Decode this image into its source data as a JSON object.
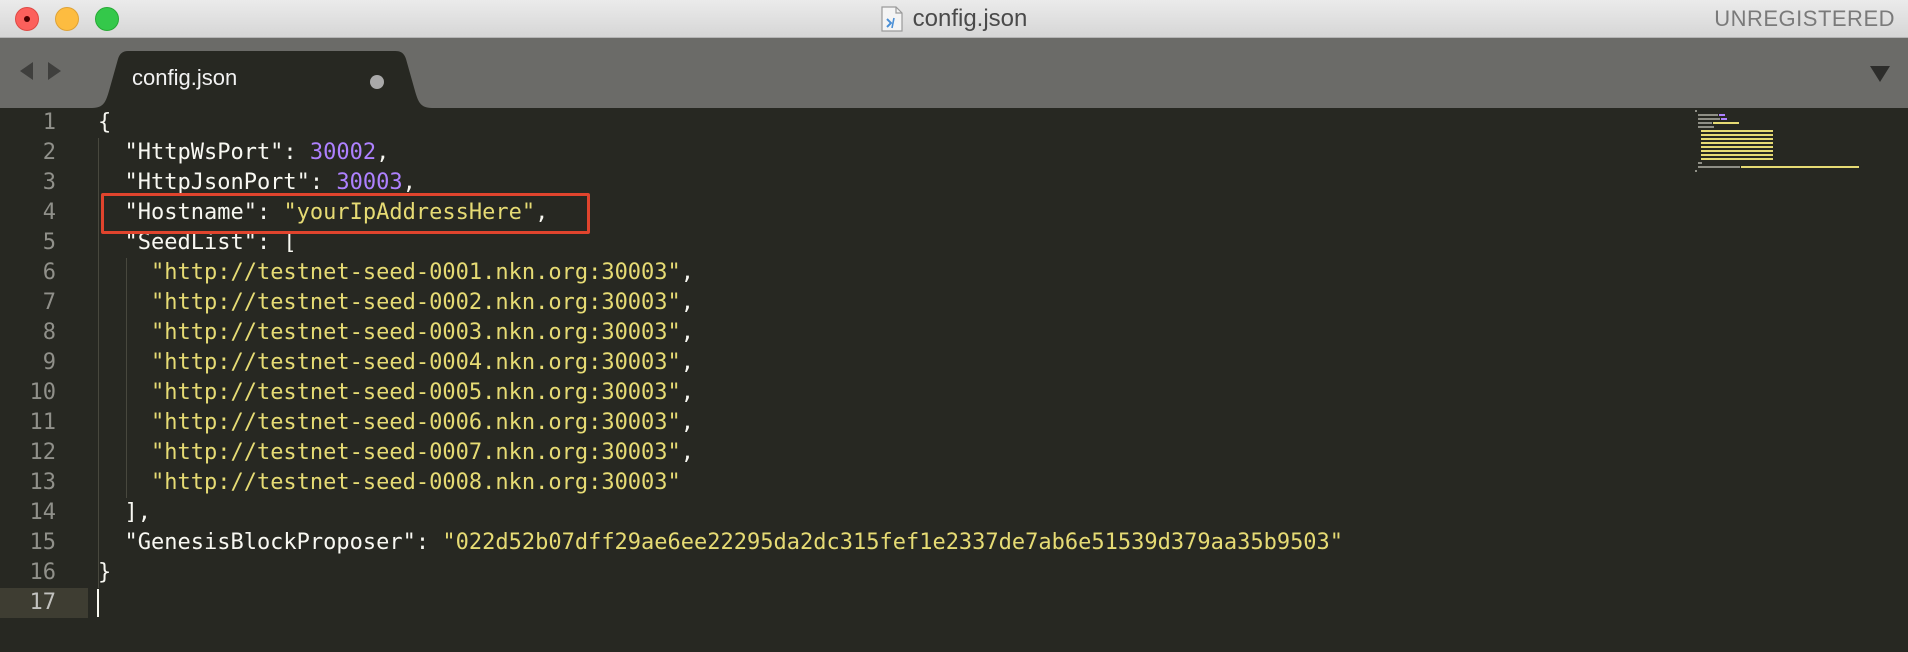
{
  "window": {
    "title": "config.json",
    "license_status": "UNREGISTERED"
  },
  "tabs": [
    {
      "label": "config.json",
      "modified": true
    }
  ],
  "editor": {
    "lines": [
      {
        "n": "1",
        "tokens": [
          {
            "t": "{",
            "c": "key"
          }
        ]
      },
      {
        "n": "2",
        "tokens": [
          {
            "t": "  \"HttpWsPort\": ",
            "c": "key"
          },
          {
            "t": "30002",
            "c": "num"
          },
          {
            "t": ",",
            "c": "key"
          }
        ]
      },
      {
        "n": "3",
        "tokens": [
          {
            "t": "  \"HttpJsonPort\": ",
            "c": "key"
          },
          {
            "t": "30003",
            "c": "num"
          },
          {
            "t": ",",
            "c": "key"
          }
        ]
      },
      {
        "n": "4",
        "tokens": [
          {
            "t": "  \"Hostname\": ",
            "c": "key"
          },
          {
            "t": "\"yourIpAddressHere\"",
            "c": "str"
          },
          {
            "t": ",",
            "c": "key"
          }
        ]
      },
      {
        "n": "5",
        "tokens": [
          {
            "t": "  \"SeedList\": [",
            "c": "key"
          }
        ]
      },
      {
        "n": "6",
        "tokens": [
          {
            "t": "    ",
            "c": "key"
          },
          {
            "t": "\"http://testnet-seed-0001.nkn.org:30003\"",
            "c": "str"
          },
          {
            "t": ",",
            "c": "key"
          }
        ]
      },
      {
        "n": "7",
        "tokens": [
          {
            "t": "    ",
            "c": "key"
          },
          {
            "t": "\"http://testnet-seed-0002.nkn.org:30003\"",
            "c": "str"
          },
          {
            "t": ",",
            "c": "key"
          }
        ]
      },
      {
        "n": "8",
        "tokens": [
          {
            "t": "    ",
            "c": "key"
          },
          {
            "t": "\"http://testnet-seed-0003.nkn.org:30003\"",
            "c": "str"
          },
          {
            "t": ",",
            "c": "key"
          }
        ]
      },
      {
        "n": "9",
        "tokens": [
          {
            "t": "    ",
            "c": "key"
          },
          {
            "t": "\"http://testnet-seed-0004.nkn.org:30003\"",
            "c": "str"
          },
          {
            "t": ",",
            "c": "key"
          }
        ]
      },
      {
        "n": "10",
        "tokens": [
          {
            "t": "    ",
            "c": "key"
          },
          {
            "t": "\"http://testnet-seed-0005.nkn.org:30003\"",
            "c": "str"
          },
          {
            "t": ",",
            "c": "key"
          }
        ]
      },
      {
        "n": "11",
        "tokens": [
          {
            "t": "    ",
            "c": "key"
          },
          {
            "t": "\"http://testnet-seed-0006.nkn.org:30003\"",
            "c": "str"
          },
          {
            "t": ",",
            "c": "key"
          }
        ]
      },
      {
        "n": "12",
        "tokens": [
          {
            "t": "    ",
            "c": "key"
          },
          {
            "t": "\"http://testnet-seed-0007.nkn.org:30003\"",
            "c": "str"
          },
          {
            "t": ",",
            "c": "key"
          }
        ]
      },
      {
        "n": "13",
        "tokens": [
          {
            "t": "    ",
            "c": "key"
          },
          {
            "t": "\"http://testnet-seed-0008.nkn.org:30003\"",
            "c": "str"
          }
        ]
      },
      {
        "n": "14",
        "tokens": [
          {
            "t": "  ],",
            "c": "key"
          }
        ]
      },
      {
        "n": "15",
        "tokens": [
          {
            "t": "  \"GenesisBlockProposer\": ",
            "c": "key"
          },
          {
            "t": "\"022d52b07dff29ae6ee22295da2dc315fef1e2337de7ab6e51539d379aa35b9503\"",
            "c": "str"
          }
        ]
      },
      {
        "n": "16",
        "tokens": [
          {
            "t": "}",
            "c": "key"
          }
        ]
      },
      {
        "n": "17",
        "tokens": []
      }
    ],
    "active_line": "17"
  },
  "colors": {
    "background": "#272822",
    "string": "#e6db74",
    "number": "#ae81ff",
    "highlight_box": "#e0442d"
  }
}
